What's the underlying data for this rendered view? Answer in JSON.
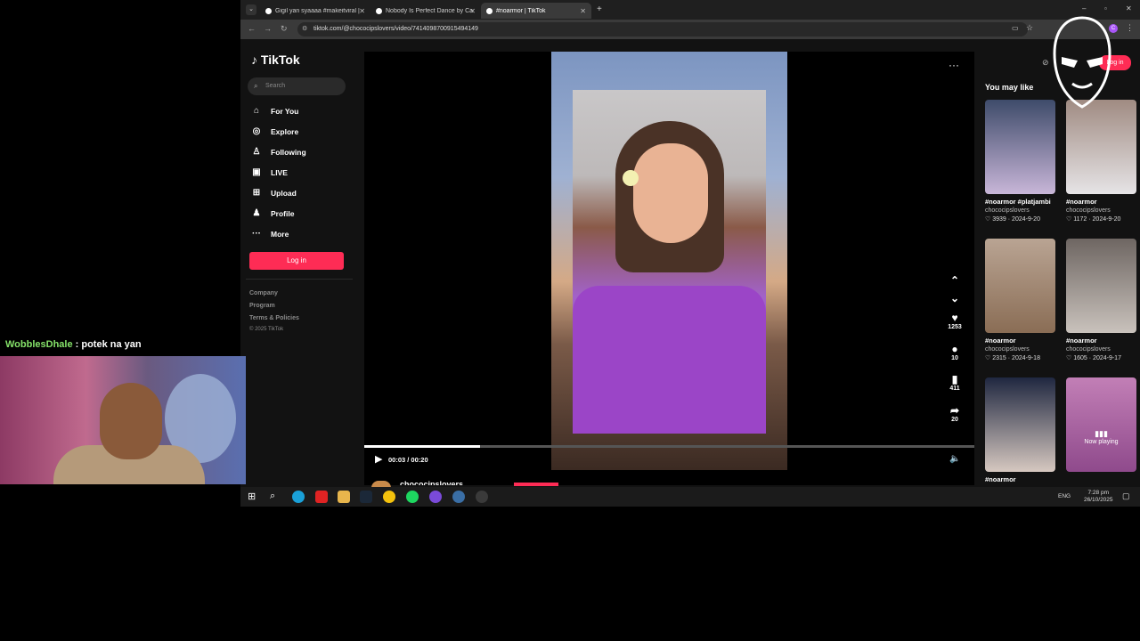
{
  "browser": {
    "tabs": [
      {
        "title": "Gigil yan syaaaa #makeitviral | "
      },
      {
        "title": "Nobody Is Perfect Dance by Ca"
      },
      {
        "title": "#noarmor | TikTok"
      }
    ],
    "url": "tiktok.com/@chococipslovers/video/7414098700915494149"
  },
  "tiktok": {
    "logo": "TikTok",
    "search_placeholder": "Search",
    "nav": [
      {
        "label": "For You",
        "icon": "home-icon"
      },
      {
        "label": "Explore",
        "icon": "compass-icon"
      },
      {
        "label": "Following",
        "icon": "following-icon"
      },
      {
        "label": "LIVE",
        "icon": "live-icon"
      },
      {
        "label": "Upload",
        "icon": "upload-icon"
      },
      {
        "label": "Profile",
        "icon": "profile-icon"
      },
      {
        "label": "More",
        "icon": "more-icon"
      }
    ],
    "login_label": "Log in",
    "footer": [
      "Company",
      "Program",
      "Terms & Policies",
      "© 2025 TikTok"
    ]
  },
  "player": {
    "progress": 0.19,
    "time": "00:03 / 00:20",
    "likes": "1253",
    "comments": "10",
    "saves": "411",
    "shares": "20",
    "author": "chococipslovers"
  },
  "right_panel": {
    "title": "You may like",
    "login_label": "Log in",
    "now_playing": "Now playing",
    "cards": [
      {
        "caption": "#noarmor #platjambi",
        "author": "chococipslovers",
        "likes": "3939",
        "date": "2024-9-20",
        "color": "#6f7fa2"
      },
      {
        "caption": "#noarmor",
        "author": "chococipslovers",
        "likes": "1172",
        "date": "2024-9-20",
        "color": "#b4a59a"
      },
      {
        "caption": "#noarmor",
        "author": "chococipslovers",
        "likes": "2315",
        "date": "2024-9-18",
        "color": "#a78c70"
      },
      {
        "caption": "#noarmor",
        "author": "chococipslovers",
        "likes": "1605",
        "date": "2024-9-17",
        "color": "#8c7f78"
      },
      {
        "caption": "#noarmor",
        "author": "",
        "likes": "",
        "date": "",
        "color": "#2d3550"
      },
      {
        "caption": "",
        "author": "",
        "likes": "",
        "date": "",
        "color": "#a55a9a"
      }
    ]
  },
  "taskbar": {
    "lang": "ENG",
    "time": "7:28 pm",
    "date": "26/10/2025"
  },
  "overlay": {
    "chat_user": "WobblesDhale",
    "chat_message": " : potek na yan"
  }
}
